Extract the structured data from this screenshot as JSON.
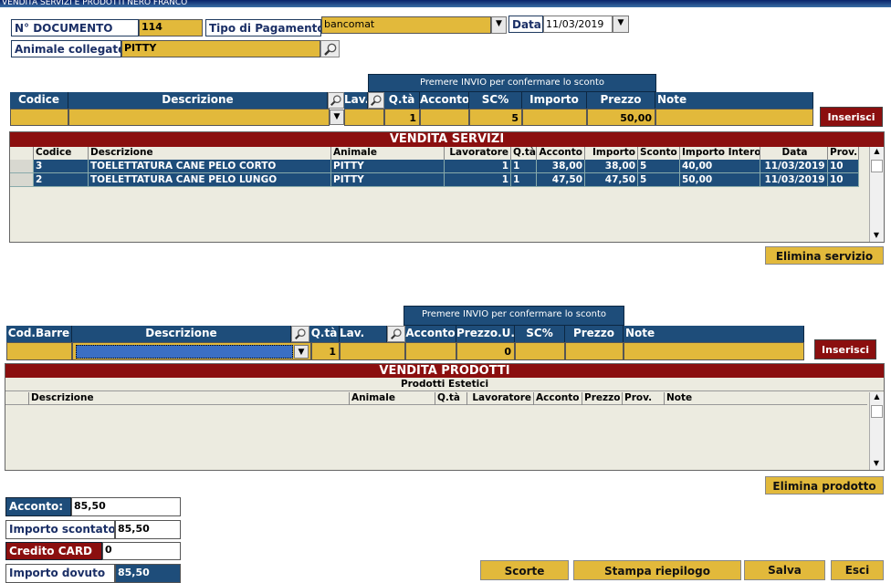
{
  "window": {
    "title": "VENDITA SERVIZI E PRODOTTI NERO FRANCO"
  },
  "header": {
    "doc_label": "N° DOCUMENTO",
    "doc_value": "114",
    "payment_label": "Tipo di Pagamento:",
    "payment_value": "bancomat",
    "date_label": "Data:",
    "date_value": "11/03/2019",
    "animal_label": "Animale collegato:",
    "animal_value": "PITTY"
  },
  "services_entry": {
    "banner": "Premere INVIO per confermare lo sconto",
    "headers": {
      "codice": "Codice",
      "descrizione": "Descrizione",
      "lav": "Lav.",
      "qta": "Q.tà",
      "acconto": "Acconto",
      "sc": "SC%",
      "importo": "Importo",
      "prezzo": "Prezzo",
      "note": "Note"
    },
    "values": {
      "qta": "1",
      "sc": "5",
      "prezzo": "50,00"
    },
    "insert_button": "Inserisci"
  },
  "services_grid": {
    "title": "VENDITA SERVIZI",
    "columns": [
      "Codice",
      "Descrizione",
      "Animale",
      "Lavoratore",
      "Q.tà",
      "Acconto",
      "Importo",
      "Sconto",
      "Importo Intero",
      "Data",
      "Prov."
    ],
    "rows": [
      [
        "3",
        "TOELETTATURA CANE PELO CORTO",
        "PITTY",
        "1",
        "1",
        "38,00",
        "38,00",
        "5",
        "40,00",
        "11/03/2019",
        "10"
      ],
      [
        "2",
        "TOELETTATURA CANE PELO LUNGO",
        "PITTY",
        "1",
        "1",
        "47,50",
        "47,50",
        "5",
        "50,00",
        "11/03/2019",
        "10"
      ]
    ],
    "delete_button": "Elimina servizio"
  },
  "products_entry": {
    "banner": "Premere INVIO per confermare lo sconto",
    "headers": {
      "barcode": "Cod.Barre",
      "descrizione": "Descrizione",
      "qta": "Q.tà",
      "lav": "Lav.",
      "acconto": "Acconto",
      "prezzo_u": "Prezzo.U.",
      "sc": "SC%",
      "prezzo": "Prezzo",
      "note": "Note"
    },
    "values": {
      "qta": "1",
      "prezzo_u": "0"
    },
    "insert_button": "Inserisci"
  },
  "products_grid": {
    "title": "VENDITA PRODOTTI",
    "subtitle": "Prodotti Estetici",
    "columns": [
      "Descrizione",
      "Animale",
      "Q.tà",
      "Lavoratore",
      "Acconto",
      "Prezzo",
      "Prov.",
      "Note"
    ],
    "delete_button": "Elimina prodotto"
  },
  "totals": {
    "acconto_label": "Acconto:",
    "acconto_value": "85,50",
    "scontato_label": "Importo scontato:",
    "scontato_value": "85,50",
    "credito_label": "Credito CARD",
    "credito_value": "0",
    "dovuto_label": "Importo dovuto",
    "dovuto_value": "85,50"
  },
  "footer": {
    "scorte": "Scorte",
    "stampa": "Stampa riepilogo",
    "salva": "Salva",
    "esci": "Esci"
  },
  "colors": {
    "navy": "#1e4d7a",
    "gold": "#e2b93b",
    "dark_red": "#8b0f0f",
    "grid_bg": "#ecebe0"
  }
}
